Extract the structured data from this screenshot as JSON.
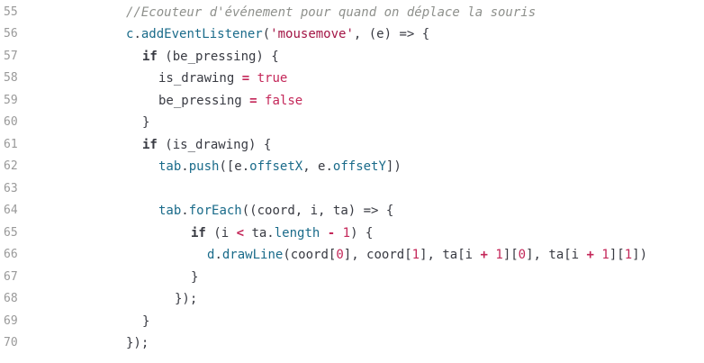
{
  "theme": {
    "background": "#ffffff",
    "line_number_color": "#999999",
    "comment_color": "#8e908c",
    "string_color": "#a31545",
    "literal_color": "#c42759",
    "member_color": "#1a6b8a",
    "text_color": "#383a42"
  },
  "lines": [
    {
      "n": "55",
      "indent": 140,
      "tokens": [
        {
          "t": "//Ecouteur d'événement pour quand on déplace la souris",
          "c": "comment"
        }
      ]
    },
    {
      "n": "56",
      "indent": 140,
      "tokens": [
        {
          "t": "c",
          "c": "member"
        },
        {
          "t": ".",
          "c": "plain"
        },
        {
          "t": "addEventListener",
          "c": "member"
        },
        {
          "t": "(",
          "c": "plain"
        },
        {
          "t": "'mousemove'",
          "c": "string"
        },
        {
          "t": ", (e) => {",
          "c": "plain"
        }
      ]
    },
    {
      "n": "57",
      "indent": 158,
      "tokens": [
        {
          "t": "if",
          "c": "keyword"
        },
        {
          "t": " (be_pressing) {",
          "c": "plain"
        }
      ]
    },
    {
      "n": "58",
      "indent": 176,
      "tokens": [
        {
          "t": "is_drawing ",
          "c": "plain"
        },
        {
          "t": "=",
          "c": "op"
        },
        {
          "t": " ",
          "c": "plain"
        },
        {
          "t": "true",
          "c": "bool"
        }
      ]
    },
    {
      "n": "59",
      "indent": 176,
      "tokens": [
        {
          "t": "be_pressing ",
          "c": "plain"
        },
        {
          "t": "=",
          "c": "op"
        },
        {
          "t": " ",
          "c": "plain"
        },
        {
          "t": "false",
          "c": "bool"
        }
      ]
    },
    {
      "n": "60",
      "indent": 158,
      "tokens": [
        {
          "t": "}",
          "c": "plain"
        }
      ]
    },
    {
      "n": "61",
      "indent": 158,
      "tokens": [
        {
          "t": "if",
          "c": "keyword"
        },
        {
          "t": " (is_drawing) {",
          "c": "plain"
        }
      ]
    },
    {
      "n": "62",
      "indent": 176,
      "tokens": [
        {
          "t": "tab",
          "c": "member"
        },
        {
          "t": ".",
          "c": "plain"
        },
        {
          "t": "push",
          "c": "member"
        },
        {
          "t": "([e.",
          "c": "plain"
        },
        {
          "t": "offsetX",
          "c": "member"
        },
        {
          "t": ", e.",
          "c": "plain"
        },
        {
          "t": "offsetY",
          "c": "member"
        },
        {
          "t": "])",
          "c": "plain"
        }
      ]
    },
    {
      "n": "63",
      "indent": 176,
      "tokens": []
    },
    {
      "n": "64",
      "indent": 176,
      "tokens": [
        {
          "t": "tab",
          "c": "member"
        },
        {
          "t": ".",
          "c": "plain"
        },
        {
          "t": "forEach",
          "c": "member"
        },
        {
          "t": "((coord, i, ta) => {",
          "c": "plain"
        }
      ]
    },
    {
      "n": "65",
      "indent": 212,
      "tokens": [
        {
          "t": "if",
          "c": "keyword"
        },
        {
          "t": " (i ",
          "c": "plain"
        },
        {
          "t": "<",
          "c": "op"
        },
        {
          "t": " ta.",
          "c": "plain"
        },
        {
          "t": "length",
          "c": "member"
        },
        {
          "t": " ",
          "c": "plain"
        },
        {
          "t": "-",
          "c": "op"
        },
        {
          "t": " ",
          "c": "plain"
        },
        {
          "t": "1",
          "c": "number"
        },
        {
          "t": ") {",
          "c": "plain"
        }
      ]
    },
    {
      "n": "66",
      "indent": 230,
      "tokens": [
        {
          "t": "d",
          "c": "member"
        },
        {
          "t": ".",
          "c": "plain"
        },
        {
          "t": "drawLine",
          "c": "member"
        },
        {
          "t": "(coord[",
          "c": "plain"
        },
        {
          "t": "0",
          "c": "number"
        },
        {
          "t": "], coord[",
          "c": "plain"
        },
        {
          "t": "1",
          "c": "number"
        },
        {
          "t": "], ta[i ",
          "c": "plain"
        },
        {
          "t": "+",
          "c": "op"
        },
        {
          "t": " ",
          "c": "plain"
        },
        {
          "t": "1",
          "c": "number"
        },
        {
          "t": "][",
          "c": "plain"
        },
        {
          "t": "0",
          "c": "number"
        },
        {
          "t": "], ta[i ",
          "c": "plain"
        },
        {
          "t": "+",
          "c": "op"
        },
        {
          "t": " ",
          "c": "plain"
        },
        {
          "t": "1",
          "c": "number"
        },
        {
          "t": "][",
          "c": "plain"
        },
        {
          "t": "1",
          "c": "number"
        },
        {
          "t": "])",
          "c": "plain"
        }
      ]
    },
    {
      "n": "67",
      "indent": 212,
      "tokens": [
        {
          "t": "}",
          "c": "plain"
        }
      ]
    },
    {
      "n": "68",
      "indent": 194,
      "tokens": [
        {
          "t": "});",
          "c": "plain"
        }
      ]
    },
    {
      "n": "69",
      "indent": 158,
      "tokens": [
        {
          "t": "}",
          "c": "plain"
        }
      ]
    },
    {
      "n": "70",
      "indent": 140,
      "tokens": [
        {
          "t": "});",
          "c": "plain"
        }
      ]
    }
  ]
}
